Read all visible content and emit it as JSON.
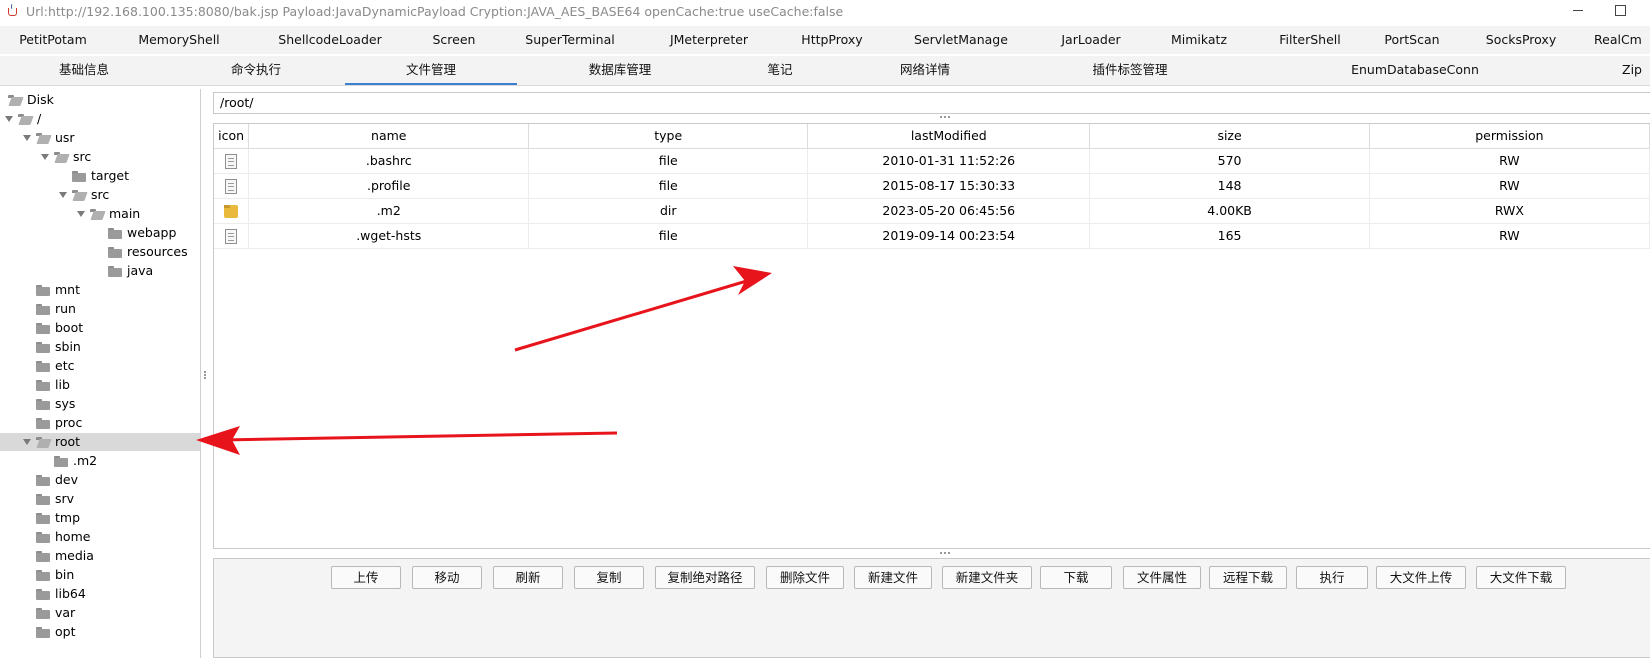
{
  "window": {
    "title": "Url:http://192.168.100.135:8080/bak.jsp Payload:JavaDynamicPayload Cryption:JAVA_AES_BASE64 openCache:true useCache:false"
  },
  "plugin_tabs": [
    "PetitPotam",
    "MemoryShell",
    "ShellcodeLoader",
    "Screen",
    "SuperTerminal",
    "JMeterpreter",
    "HttpProxy",
    "ServletManage",
    "JarLoader",
    "Mimikatz",
    "FilterShell",
    "PortScan",
    "SocksProxy",
    "RealCm"
  ],
  "main_tabs": [
    "基础信息",
    "命令执行",
    "文件管理",
    "数据库管理",
    "笔记",
    "网络详情",
    "插件标签管理",
    "EnumDatabaseConn",
    "Zip"
  ],
  "active_main_tab": "文件管理",
  "tree": [
    {
      "label": "Disk",
      "depth": 0,
      "toggle": "none",
      "folder": "open"
    },
    {
      "label": "/",
      "depth": 0,
      "toggle": "open",
      "folder": "open"
    },
    {
      "label": "usr",
      "depth": 1,
      "toggle": "open",
      "folder": "open"
    },
    {
      "label": "src",
      "depth": 2,
      "toggle": "open",
      "folder": "open"
    },
    {
      "label": "target",
      "depth": 3,
      "toggle": "none",
      "folder": "closed"
    },
    {
      "label": "src",
      "depth": 3,
      "toggle": "open",
      "folder": "open"
    },
    {
      "label": "main",
      "depth": 4,
      "toggle": "open",
      "folder": "open"
    },
    {
      "label": "webapp",
      "depth": 5,
      "toggle": "none",
      "folder": "closed"
    },
    {
      "label": "resources",
      "depth": 5,
      "toggle": "none",
      "folder": "closed"
    },
    {
      "label": "java",
      "depth": 5,
      "toggle": "none",
      "folder": "closed"
    },
    {
      "label": "mnt",
      "depth": 1,
      "toggle": "none",
      "folder": "closed"
    },
    {
      "label": "run",
      "depth": 1,
      "toggle": "none",
      "folder": "closed"
    },
    {
      "label": "boot",
      "depth": 1,
      "toggle": "none",
      "folder": "closed"
    },
    {
      "label": "sbin",
      "depth": 1,
      "toggle": "none",
      "folder": "closed"
    },
    {
      "label": "etc",
      "depth": 1,
      "toggle": "none",
      "folder": "closed"
    },
    {
      "label": "lib",
      "depth": 1,
      "toggle": "none",
      "folder": "closed"
    },
    {
      "label": "sys",
      "depth": 1,
      "toggle": "none",
      "folder": "closed"
    },
    {
      "label": "proc",
      "depth": 1,
      "toggle": "none",
      "folder": "closed"
    },
    {
      "label": "root",
      "depth": 1,
      "toggle": "open",
      "folder": "open",
      "selected": true
    },
    {
      "label": ".m2",
      "depth": 2,
      "toggle": "none",
      "folder": "closed"
    },
    {
      "label": "dev",
      "depth": 1,
      "toggle": "none",
      "folder": "closed"
    },
    {
      "label": "srv",
      "depth": 1,
      "toggle": "none",
      "folder": "closed"
    },
    {
      "label": "tmp",
      "depth": 1,
      "toggle": "none",
      "folder": "closed"
    },
    {
      "label": "home",
      "depth": 1,
      "toggle": "none",
      "folder": "closed"
    },
    {
      "label": "media",
      "depth": 1,
      "toggle": "none",
      "folder": "closed"
    },
    {
      "label": "bin",
      "depth": 1,
      "toggle": "none",
      "folder": "closed"
    },
    {
      "label": "lib64",
      "depth": 1,
      "toggle": "none",
      "folder": "closed"
    },
    {
      "label": "var",
      "depth": 1,
      "toggle": "none",
      "folder": "closed"
    },
    {
      "label": "opt",
      "depth": 1,
      "toggle": "none",
      "folder": "closed"
    }
  ],
  "path": "/root/",
  "table": {
    "columns": [
      "icon",
      "name",
      "type",
      "lastModified",
      "size",
      "permission"
    ],
    "rows": [
      {
        "icon": "file-icon",
        "name": ".bashrc",
        "type": "file",
        "lastModified": "2010-01-31 11:52:26",
        "size": "570",
        "permission": "RW"
      },
      {
        "icon": "file-icon",
        "name": ".profile",
        "type": "file",
        "lastModified": "2015-08-17 15:30:33",
        "size": "148",
        "permission": "RW"
      },
      {
        "icon": "folder-icon",
        "name": ".m2",
        "type": "dir",
        "lastModified": "2023-05-20 06:45:56",
        "size": "4.00KB",
        "permission": "RWX"
      },
      {
        "icon": "file-icon",
        "name": ".wget-hsts",
        "type": "file",
        "lastModified": "2019-09-14 00:23:54",
        "size": "165",
        "permission": "RW"
      }
    ]
  },
  "actions": [
    "上传",
    "移动",
    "刷新",
    "复制",
    "复制绝对路径",
    "删除文件",
    "新建文件",
    "新建文件夹",
    "下载",
    "文件属性",
    "远程下载",
    "执行",
    "大文件上传",
    "大文件下载"
  ],
  "annotation_color": "#e8141c",
  "accent_color": "#3d7fd1"
}
